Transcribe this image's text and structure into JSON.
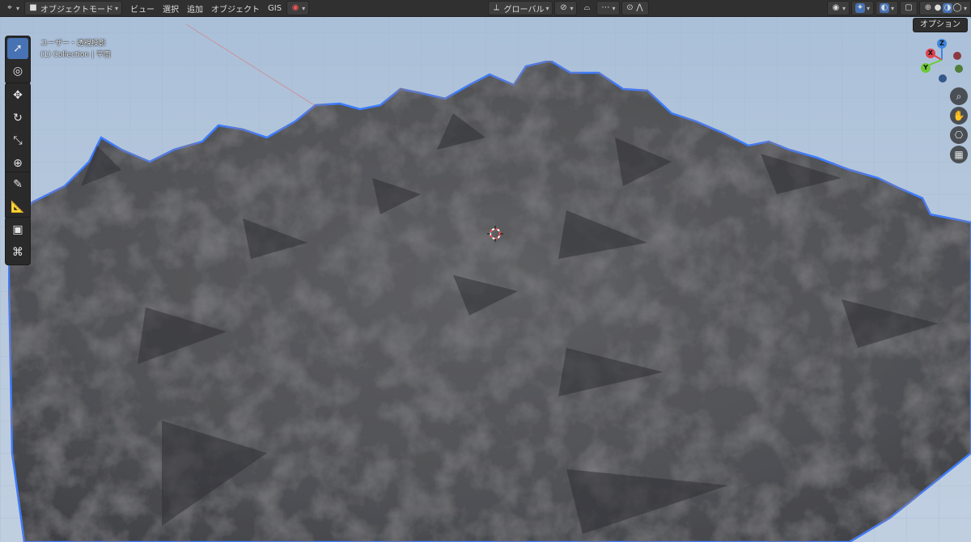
{
  "header": {
    "mode": "オブジェクトモード",
    "menus": [
      "ビュー",
      "選択",
      "追加",
      "オブジェクト",
      "GIS"
    ],
    "orientation": "グローバル"
  },
  "options_label": "オプション",
  "viewport": {
    "view_name": "ユーザー・透視投影",
    "collection_info": "(1) Collection | 平面"
  },
  "gizmo": {
    "z": "Z",
    "x": "X",
    "y": "Y"
  },
  "colors": {
    "accent": "#4772b3",
    "selection_outline": "#3a7bff",
    "gizmo_x": "#e0424f",
    "gizmo_y": "#6ec936",
    "gizmo_z": "#3f86e0"
  },
  "icons": {
    "toolbar": [
      "select-box-icon",
      "cursor-icon",
      "move-icon",
      "rotate-icon",
      "scale-icon",
      "transform-icon",
      "annotate-icon",
      "measure-icon",
      "add-cube-icon",
      "gis-icon"
    ],
    "nav": [
      "zoom-icon",
      "hand-pan-icon",
      "camera-icon",
      "grid-ortho-icon"
    ]
  }
}
